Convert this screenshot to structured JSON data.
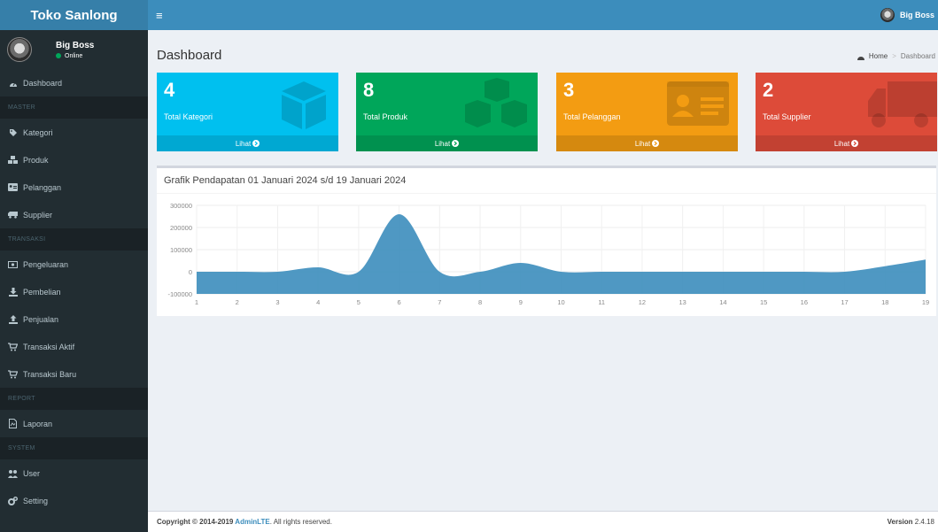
{
  "brand": {
    "name": "Toko Sanlong"
  },
  "user": {
    "name": "Big Boss",
    "status": "Online"
  },
  "sidebar": {
    "dashboard": "Dashboard",
    "headers": {
      "master": "MASTER",
      "transaksi": "TRANSAKSI",
      "report": "REPORT",
      "system": "SYSTEM"
    },
    "items": {
      "kategori": "Kategori",
      "produk": "Produk",
      "pelanggan": "Pelanggan",
      "supplier": "Supplier",
      "pengeluaran": "Pengeluaran",
      "pembelian": "Pembelian",
      "penjualan": "Penjualan",
      "transaksi_aktif": "Transaksi Aktif",
      "transaksi_baru": "Transaksi Baru",
      "laporan": "Laporan",
      "user": "User",
      "setting": "Setting"
    }
  },
  "navbar": {
    "user_name": "Big Boss"
  },
  "header": {
    "title": "Dashboard",
    "breadcrumb_home": "Home",
    "breadcrumb_current": "Dashboard"
  },
  "boxes": [
    {
      "count": "4",
      "label": "Total Kategori",
      "link": "Lihat",
      "color": "#00c0ef",
      "icon": "cube-icon"
    },
    {
      "count": "8",
      "label": "Total Produk",
      "link": "Lihat",
      "color": "#00a65a",
      "icon": "cubes-icon"
    },
    {
      "count": "3",
      "label": "Total Pelanggan",
      "link": "Lihat",
      "color": "#f39c12",
      "icon": "id-card-icon"
    },
    {
      "count": "2",
      "label": "Total Supplier",
      "link": "Lihat",
      "color": "#dd4b39",
      "icon": "truck-icon"
    }
  ],
  "chart": {
    "title": "Grafik Pendapatan 01 Januari 2024 s/d 19 Januari 2024"
  },
  "chart_data": {
    "type": "area",
    "x": [
      1,
      2,
      3,
      4,
      5,
      6,
      7,
      8,
      9,
      10,
      11,
      12,
      13,
      14,
      15,
      16,
      17,
      18,
      19
    ],
    "series": [
      {
        "values": [
          0,
          0,
          0,
          20000,
          0,
          260000,
          0,
          0,
          40000,
          0,
          0,
          0,
          0,
          0,
          0,
          0,
          0,
          25000,
          55000
        ]
      }
    ],
    "yticks": [
      300000,
      200000,
      100000,
      0,
      -100000
    ],
    "ylim": [
      -100000,
      300000
    ],
    "color": "#3c8dbc",
    "grid": true
  },
  "footer": {
    "copyright_prefix": "Copyright © 2014-2019 ",
    "copyright_link": "AdminLTE",
    "copyright_suffix": ". All rights reserved.",
    "version_label": "Version",
    "version_value": "2.4.18"
  }
}
